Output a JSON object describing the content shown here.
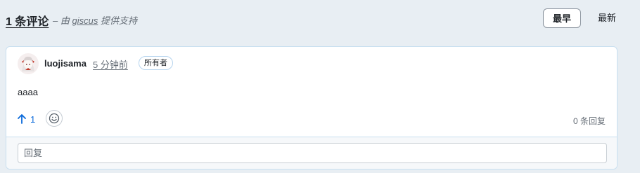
{
  "header": {
    "count_label": "1 条评论",
    "powered_prefix": "– 由",
    "powered_brand": "giscus",
    "powered_suffix": "提供支持",
    "sort_oldest": "最早",
    "sort_newest": "最新",
    "sort_active": "最早"
  },
  "comment": {
    "author": "luojisama",
    "timestamp": "5 分钟前",
    "badge": "所有者",
    "body": "aaaa",
    "upvote_count": "1",
    "reply_count_label": "0 条回复"
  },
  "reply": {
    "placeholder": "回复"
  },
  "icons": {
    "upvote": "arrow-up-icon",
    "reaction": "smiley-icon",
    "avatar": "anime-avatar"
  },
  "colors": {
    "page_bg": "#e8eef3",
    "accent": "#0969da",
    "card_border": "#c8dff0",
    "badge_border": "#b6d4ee"
  }
}
